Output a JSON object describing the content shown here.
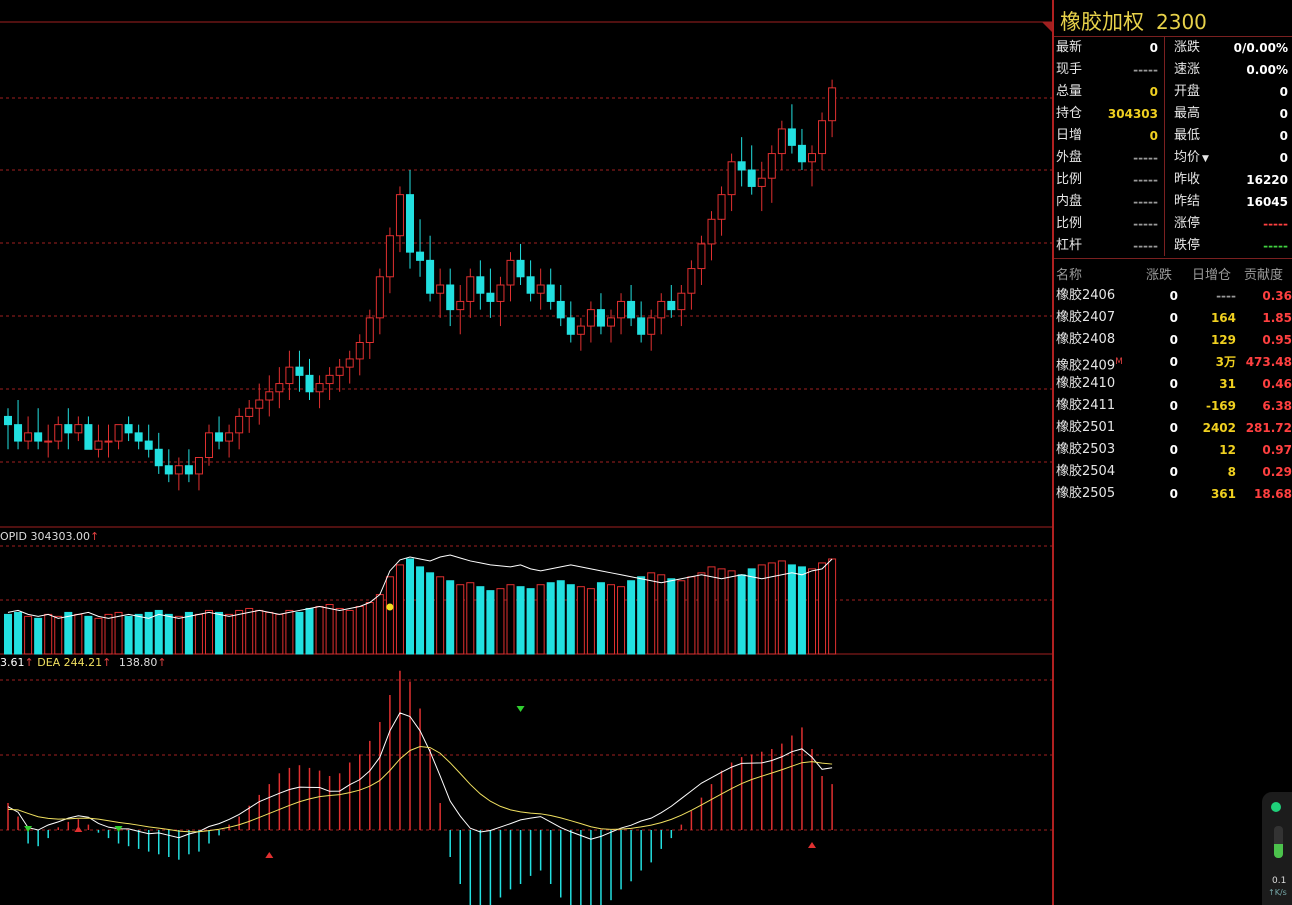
{
  "instrument": {
    "name": "橡胶加权",
    "code": "2300"
  },
  "quote_left": [
    {
      "label": "最新",
      "value": "0",
      "color": "w"
    },
    {
      "label": "现手",
      "value": "-----",
      "color": "dim"
    },
    {
      "label": "总量",
      "value": "0",
      "color": "y"
    },
    {
      "label": "持仓",
      "value": "304303",
      "color": "y"
    },
    {
      "label": "日增",
      "value": "0",
      "color": "y"
    },
    {
      "label": "外盘",
      "value": "-----",
      "color": "dim"
    },
    {
      "label": "比例",
      "value": "-----",
      "color": "dim"
    },
    {
      "label": "内盘",
      "value": "-----",
      "color": "dim"
    },
    {
      "label": "比例",
      "value": "-----",
      "color": "dim"
    },
    {
      "label": "杠杆",
      "value": "-----",
      "color": "dim"
    }
  ],
  "quote_right": [
    {
      "label": "涨跌",
      "value": "0/0.00%",
      "color": "w"
    },
    {
      "label": "速涨",
      "value": "0.00%",
      "color": "w"
    },
    {
      "label": "开盘",
      "value": "0",
      "color": "w"
    },
    {
      "label": "最高",
      "value": "0",
      "color": "w"
    },
    {
      "label": "最低",
      "value": "0",
      "color": "w"
    },
    {
      "label": "均价",
      "value": "0",
      "color": "w",
      "dropdown": true
    },
    {
      "label": "昨收",
      "value": "16220",
      "color": "w"
    },
    {
      "label": "昨结",
      "value": "16045",
      "color": "w"
    },
    {
      "label": "涨停",
      "value": "-----",
      "color": "r"
    },
    {
      "label": "跌停",
      "value": "-----",
      "color": "g"
    }
  ],
  "contracts_header": [
    "名称",
    "涨跌",
    "日增仓",
    "贡献度"
  ],
  "contracts": [
    {
      "name": "橡胶2406",
      "mark": "",
      "chg": "0",
      "inc": "----",
      "contrib": "0.36",
      "inc_color": "dim"
    },
    {
      "name": "橡胶2407",
      "mark": "",
      "chg": "0",
      "inc": "164",
      "contrib": "1.85",
      "inc_color": "y"
    },
    {
      "name": "橡胶2408",
      "mark": "",
      "chg": "0",
      "inc": "129",
      "contrib": "0.95",
      "inc_color": "y"
    },
    {
      "name": "橡胶2409",
      "mark": "M",
      "chg": "0",
      "inc": "3万",
      "contrib": "473.48",
      "inc_color": "y"
    },
    {
      "name": "橡胶2410",
      "mark": "",
      "chg": "0",
      "inc": "31",
      "contrib": "0.46",
      "inc_color": "y"
    },
    {
      "name": "橡胶2411",
      "mark": "",
      "chg": "0",
      "inc": "-169",
      "contrib": "6.38",
      "inc_color": "y"
    },
    {
      "name": "橡胶2501",
      "mark": "",
      "chg": "0",
      "inc": "2402",
      "contrib": "281.72",
      "inc_color": "y"
    },
    {
      "name": "橡胶2503",
      "mark": "",
      "chg": "0",
      "inc": "12",
      "contrib": "0.97",
      "inc_color": "y"
    },
    {
      "name": "橡胶2504",
      "mark": "",
      "chg": "0",
      "inc": "8",
      "contrib": "0.29",
      "inc_color": "y"
    },
    {
      "name": "橡胶2505",
      "mark": "",
      "chg": "0",
      "inc": "361",
      "contrib": "18.68",
      "inc_color": "y"
    }
  ],
  "indicators": {
    "opid_label": "OPID 304303.00",
    "macd_left": "3.61",
    "macd_dea": "DEA 244.21",
    "macd_right": "138.80",
    "arrow": "↑"
  },
  "widget": {
    "speed": "0.1",
    "unit": "K/s"
  },
  "colors": {
    "up": "#e03030",
    "down": "#22e0e0",
    "grid": "#a02020",
    "dif": "#ffffff",
    "dea": "#f0e060",
    "highlight": "#f0e020"
  },
  "chart_data": {
    "type": "candlestick",
    "note_units": "price index (relative)",
    "candles": [
      [
        52,
        53,
        48,
        51
      ],
      [
        51,
        54,
        48,
        49
      ],
      [
        49,
        52,
        48,
        50
      ],
      [
        50,
        53,
        48,
        49
      ],
      [
        49,
        51,
        47,
        49
      ],
      [
        49,
        52,
        48,
        51
      ],
      [
        51,
        53,
        48,
        50
      ],
      [
        50,
        52,
        49,
        51
      ],
      [
        51,
        52,
        48,
        48
      ],
      [
        48,
        51,
        47,
        49
      ],
      [
        49,
        51,
        47,
        49
      ],
      [
        49,
        51,
        48,
        51
      ],
      [
        51,
        52,
        49,
        50
      ],
      [
        50,
        51,
        48,
        49
      ],
      [
        49,
        51,
        47,
        48
      ],
      [
        48,
        50,
        45,
        46
      ],
      [
        46,
        48,
        44,
        45
      ],
      [
        45,
        47,
        43,
        46
      ],
      [
        46,
        48,
        44,
        45
      ],
      [
        45,
        47,
        43,
        47
      ],
      [
        47,
        51,
        46,
        50
      ],
      [
        50,
        52,
        48,
        49
      ],
      [
        49,
        51,
        47,
        50
      ],
      [
        50,
        53,
        48,
        52
      ],
      [
        52,
        54,
        50,
        53
      ],
      [
        53,
        56,
        51,
        54
      ],
      [
        54,
        57,
        52,
        55
      ],
      [
        55,
        58,
        53,
        56
      ],
      [
        56,
        60,
        54,
        58
      ],
      [
        58,
        60,
        55,
        57
      ],
      [
        57,
        59,
        54,
        55
      ],
      [
        55,
        57,
        53,
        56
      ],
      [
        56,
        58,
        54,
        57
      ],
      [
        57,
        59,
        55,
        58
      ],
      [
        58,
        60,
        56,
        59
      ],
      [
        59,
        62,
        57,
        61
      ],
      [
        61,
        65,
        59,
        64
      ],
      [
        64,
        70,
        62,
        69
      ],
      [
        69,
        75,
        67,
        74
      ],
      [
        74,
        80,
        72,
        79
      ],
      [
        79,
        82,
        70,
        72
      ],
      [
        72,
        76,
        69,
        71
      ],
      [
        71,
        74,
        66,
        67
      ],
      [
        67,
        70,
        64,
        68
      ],
      [
        68,
        70,
        63,
        65
      ],
      [
        65,
        68,
        62,
        66
      ],
      [
        66,
        70,
        64,
        69
      ],
      [
        69,
        71,
        65,
        67
      ],
      [
        67,
        70,
        64,
        66
      ],
      [
        66,
        69,
        63,
        68
      ],
      [
        68,
        72,
        66,
        71
      ],
      [
        71,
        73,
        68,
        69
      ],
      [
        69,
        71,
        66,
        67
      ],
      [
        67,
        70,
        65,
        68
      ],
      [
        68,
        70,
        65,
        66
      ],
      [
        66,
        68,
        63,
        64
      ],
      [
        64,
        66,
        61,
        62
      ],
      [
        62,
        64,
        60,
        63
      ],
      [
        63,
        66,
        61,
        65
      ],
      [
        65,
        67,
        62,
        63
      ],
      [
        63,
        65,
        61,
        64
      ],
      [
        64,
        67,
        62,
        66
      ],
      [
        66,
        68,
        63,
        64
      ],
      [
        64,
        66,
        61,
        62
      ],
      [
        62,
        65,
        60,
        64
      ],
      [
        64,
        67,
        62,
        66
      ],
      [
        66,
        68,
        64,
        65
      ],
      [
        65,
        68,
        63,
        67
      ],
      [
        67,
        71,
        65,
        70
      ],
      [
        70,
        74,
        68,
        73
      ],
      [
        73,
        77,
        71,
        76
      ],
      [
        76,
        80,
        74,
        79
      ],
      [
        79,
        84,
        77,
        83
      ],
      [
        83,
        86,
        80,
        82
      ],
      [
        82,
        85,
        79,
        80
      ],
      [
        80,
        83,
        77,
        81
      ],
      [
        81,
        85,
        78,
        84
      ],
      [
        84,
        88,
        82,
        87
      ],
      [
        87,
        90,
        84,
        85
      ],
      [
        85,
        87,
        82,
        83
      ],
      [
        83,
        85,
        80,
        84
      ],
      [
        84,
        89,
        82,
        88
      ],
      [
        88,
        93,
        86,
        92
      ]
    ],
    "volume": [
      40,
      42,
      38,
      36,
      40,
      38,
      42,
      40,
      38,
      36,
      40,
      42,
      38,
      40,
      42,
      44,
      40,
      38,
      42,
      40,
      44,
      42,
      40,
      44,
      46,
      44,
      42,
      40,
      44,
      42,
      46,
      48,
      50,
      46,
      44,
      48,
      52,
      60,
      78,
      90,
      96,
      88,
      82,
      78,
      74,
      70,
      72,
      68,
      64,
      66,
      70,
      68,
      66,
      70,
      72,
      74,
      70,
      68,
      66,
      72,
      70,
      68,
      74,
      78,
      82,
      80,
      76,
      74,
      78,
      82,
      88,
      86,
      84,
      80,
      86,
      90,
      92,
      94,
      90,
      88,
      86,
      92,
      96
    ],
    "oi_line": [
      42,
      44,
      40,
      38,
      40,
      36,
      38,
      40,
      42,
      38,
      36,
      38,
      40,
      38,
      36,
      40,
      38,
      36,
      38,
      40,
      42,
      40,
      38,
      40,
      42,
      44,
      42,
      40,
      42,
      44,
      46,
      48,
      46,
      44,
      46,
      48,
      52,
      60,
      84,
      95,
      98,
      96,
      94,
      98,
      100,
      97,
      94,
      92,
      90,
      89,
      88,
      90,
      86,
      84,
      86,
      88,
      90,
      88,
      86,
      84,
      82,
      80,
      78,
      76,
      74,
      72,
      74,
      76,
      78,
      80,
      78,
      76,
      78,
      80,
      78,
      76,
      78,
      80,
      82,
      80,
      84,
      86,
      96
    ],
    "macd_hist": [
      20,
      10,
      -10,
      -12,
      -6,
      2,
      6,
      8,
      4,
      -2,
      -6,
      -10,
      -12,
      -14,
      -16,
      -18,
      -20,
      -22,
      -18,
      -16,
      -10,
      -4,
      4,
      10,
      18,
      26,
      34,
      42,
      46,
      48,
      46,
      44,
      40,
      42,
      50,
      56,
      66,
      80,
      100,
      118,
      110,
      90,
      60,
      20,
      -20,
      -40,
      -56,
      -60,
      -56,
      -50,
      -44,
      -40,
      -34,
      -30,
      -40,
      -50,
      -58,
      -62,
      -66,
      -60,
      -52,
      -44,
      -38,
      -30,
      -24,
      -14,
      -6,
      4,
      14,
      24,
      34,
      44,
      50,
      54,
      56,
      58,
      60,
      64,
      70,
      76,
      60,
      40,
      34
    ]
  }
}
